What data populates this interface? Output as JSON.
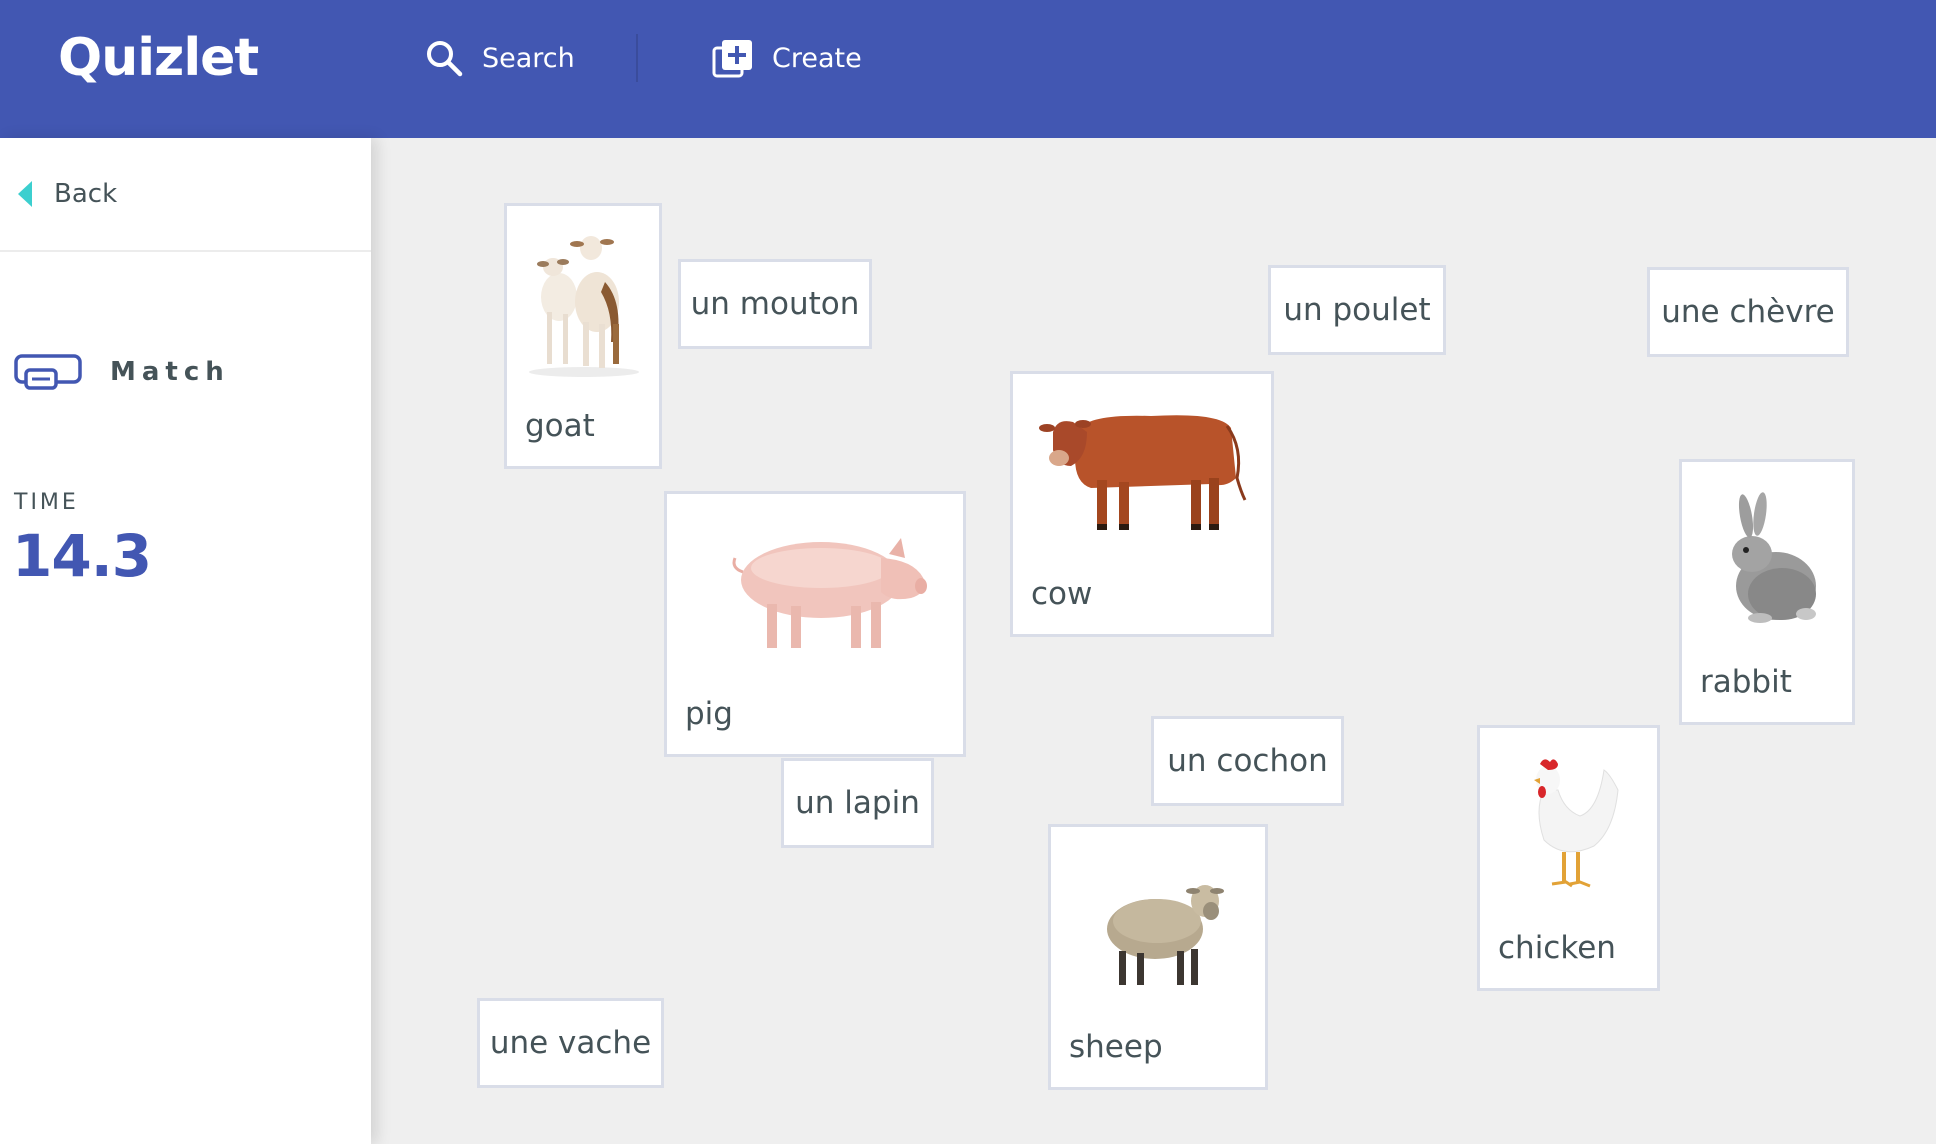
{
  "header": {
    "logo": "Quizlet",
    "search_label": "Search",
    "create_label": "Create",
    "background_color": "#4257b2"
  },
  "sidebar": {
    "back_label": "Back",
    "mode_label": "Match",
    "time_label": "TIME",
    "time_value": "14.3"
  },
  "board": {
    "image_cards": [
      {
        "label": "goat",
        "image": "goat-image"
      },
      {
        "label": "pig",
        "image": "pig-image"
      },
      {
        "label": "cow",
        "image": "cow-image"
      },
      {
        "label": "rabbit",
        "image": "rabbit-image"
      },
      {
        "label": "chicken",
        "image": "chicken-image"
      },
      {
        "label": "sheep",
        "image": "sheep-image"
      }
    ],
    "term_cards": [
      {
        "label": "un mouton"
      },
      {
        "label": "un poulet"
      },
      {
        "label": "une chèvre"
      },
      {
        "label": "un cochon"
      },
      {
        "label": "un lapin"
      },
      {
        "label": "une vache"
      }
    ]
  }
}
